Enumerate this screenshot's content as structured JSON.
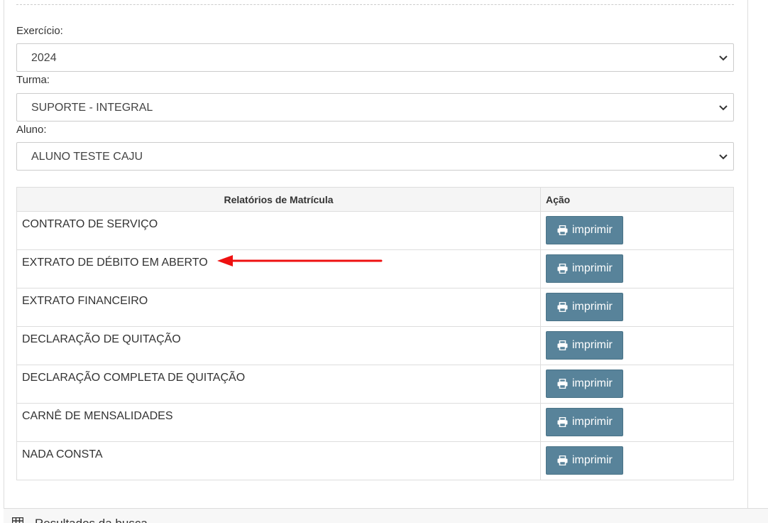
{
  "filters": {
    "exercicio": {
      "label": "Exercício:",
      "value": "2024"
    },
    "turma": {
      "label": "Turma:",
      "value": "SUPORTE - INTEGRAL"
    },
    "aluno": {
      "label": "Aluno:",
      "value": "ALUNO TESTE CAJU"
    }
  },
  "reports_table": {
    "headers": {
      "report": "Relatórios de Matrícula",
      "action": "Ação"
    },
    "rows": [
      {
        "name": "CONTRATO DE SERVIÇO",
        "button": "imprimir"
      },
      {
        "name": "EXTRATO DE DÉBITO EM ABERTO",
        "button": "imprimir"
      },
      {
        "name": "EXTRATO FINANCEIRO",
        "button": "imprimir"
      },
      {
        "name": "DECLARAÇÃO DE QUITAÇÃO",
        "button": "imprimir"
      },
      {
        "name": "DECLARAÇÃO COMPLETA DE QUITAÇÃO",
        "button": "imprimir"
      },
      {
        "name": "CARNÊ DE MENSALIDADES",
        "button": "imprimir"
      },
      {
        "name": "NADA CONSTA",
        "button": "imprimir"
      }
    ]
  },
  "bottom_panel": {
    "title": "Resultados da busca",
    "icon": "table-grid-icon"
  },
  "icons": {
    "button_icon": "printer-icon",
    "select_indicator": "chevron-down-icon"
  },
  "annotation": {
    "type": "red-arrow",
    "points_to": "EXTRATO DE DÉBITO EM ABERTO",
    "color": "#ee1111"
  },
  "colors": {
    "button_bg": "#58839a",
    "header_bg": "#f5f5f5",
    "border": "#dddddd"
  }
}
